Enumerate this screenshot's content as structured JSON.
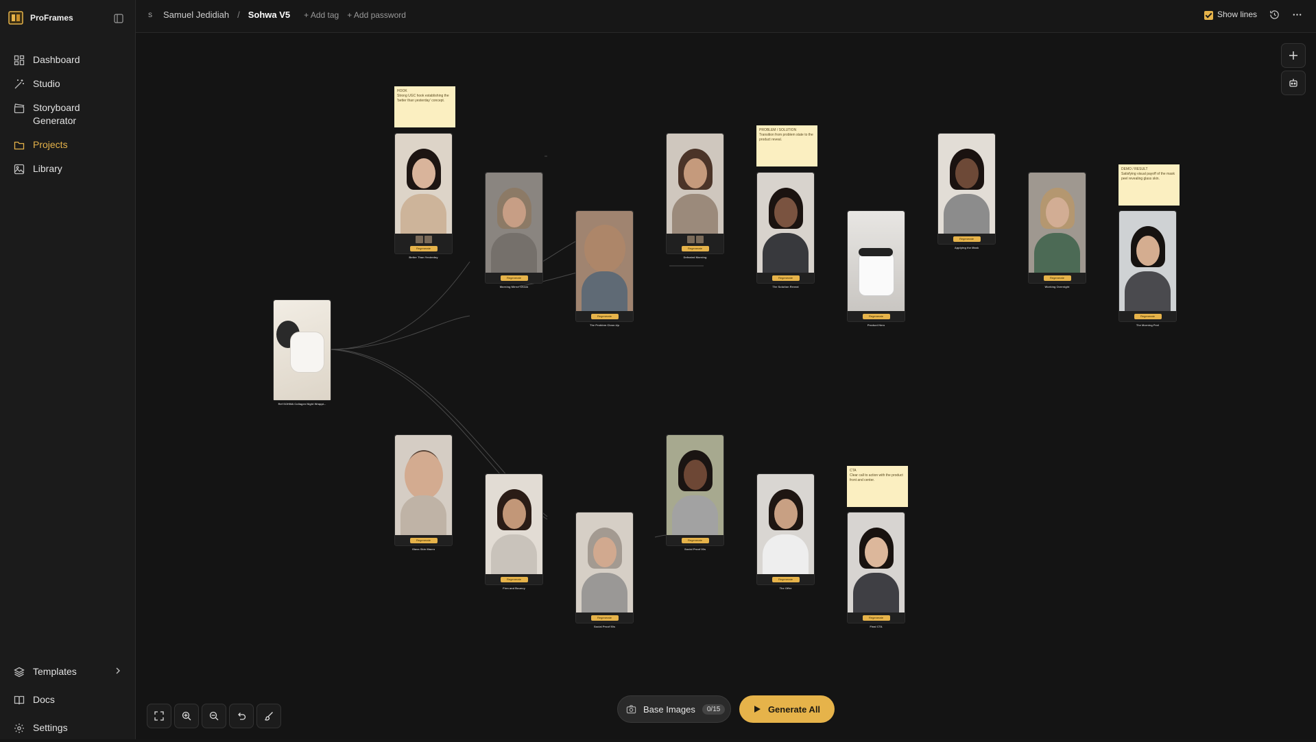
{
  "brand": {
    "name": "ProFrames",
    "accent": "#e6b34a"
  },
  "sidebar": {
    "items": [
      {
        "label": "Dashboard",
        "icon": "grid-icon"
      },
      {
        "label": "Studio",
        "icon": "wand-icon"
      },
      {
        "label": "Storyboard Generator",
        "icon": "clapperboard-icon"
      },
      {
        "label": "Projects",
        "icon": "folder-icon",
        "active": true
      },
      {
        "label": "Library",
        "icon": "image-icon"
      }
    ],
    "bottom": [
      {
        "label": "Templates",
        "icon": "layers-icon"
      },
      {
        "label": "Docs",
        "icon": "book-icon"
      },
      {
        "label": "Settings",
        "icon": "gear-icon"
      }
    ]
  },
  "header": {
    "avatar_initial": "S",
    "user": "Samuel Jedidiah",
    "separator": "/",
    "project": "Sohwa V5",
    "add_tag": "+ Add tag",
    "add_password": "+ Add password",
    "show_lines": "Show lines"
  },
  "notes": [
    {
      "title": "HOOK",
      "text": "Strong UGC hook establishing the 'better than yesterday' concept."
    },
    {
      "title": "PROBLEM / SOLUTION",
      "text": "Transition from problem state to the product reveal."
    },
    {
      "title": "DEMO / RESULT",
      "text": "Satisfying visual payoff of the mask peel revealing glass skin."
    },
    {
      "title": "CTA",
      "text": "Clear call to action with the product front and center."
    }
  ],
  "cards": {
    "regen_label": "Regenerate",
    "base": "Ref SOHWA Collagen Night Wrappi...",
    "c1": "Better Than Yesterday",
    "c2": "Morning Mirror Check",
    "c3": "The Problem Close-Up",
    "c4": "Defeated Morning",
    "c5": "The Solution Reveal",
    "c6": "Product Hero",
    "c7": "Applying the Mask",
    "c8": "Working Overnight",
    "c9": "The Morning Peel",
    "c10": "Glass Skin Macro",
    "c11": "Firm and Bouncy",
    "c12": "Social Proof 50s",
    "c13": "Social Proof 30s",
    "c14": "The Offer",
    "c15": "Final CTA"
  },
  "toolbar": {
    "base_images_label": "Base Images",
    "base_images_count": "0/15",
    "generate_label": "Generate All"
  }
}
